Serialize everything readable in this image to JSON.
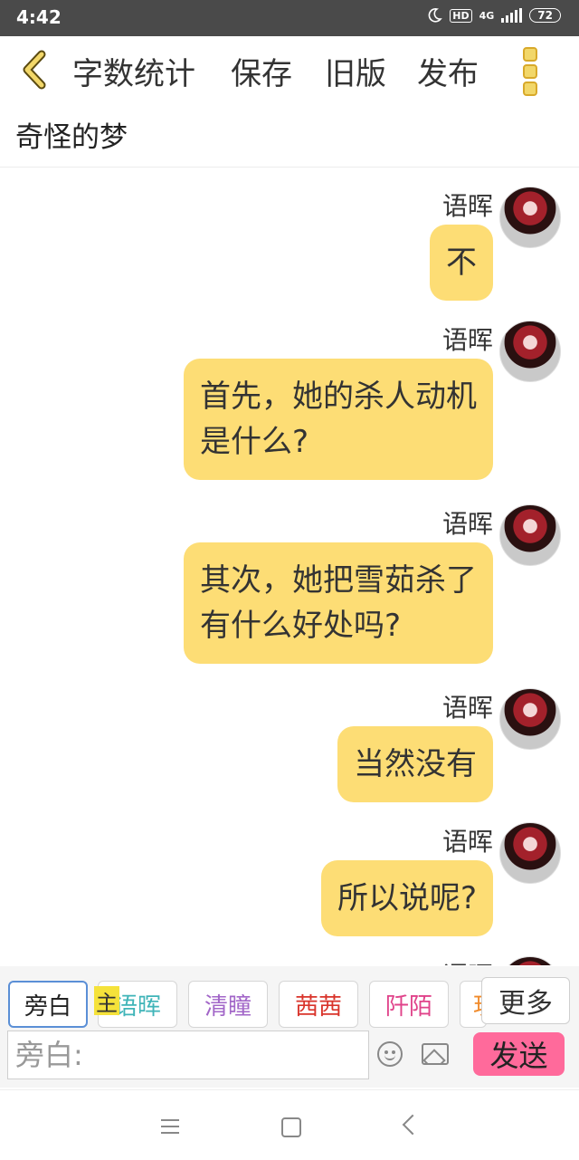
{
  "status_bar": {
    "time": "4:42",
    "hd": "HD",
    "network": "4G",
    "battery": "72"
  },
  "toolbar": {
    "word_count": "字数统计",
    "save": "保存",
    "old_version": "旧版",
    "publish": "发布"
  },
  "document": {
    "title": "奇怪的梦"
  },
  "messages": [
    {
      "name": "语晖",
      "text": "不"
    },
    {
      "name": "语晖",
      "lines": [
        "首先，她的杀人动机",
        "是什么?"
      ]
    },
    {
      "name": "语晖",
      "lines": [
        "其次，她把雪茹杀了",
        "有什么好处吗?"
      ]
    },
    {
      "name": "语晖",
      "text": "当然没有"
    },
    {
      "name": "语晖",
      "text": "所以说呢?"
    },
    {
      "name": "语晖"
    }
  ],
  "roles": {
    "items": [
      {
        "label": "旁白",
        "color": "#333333"
      },
      {
        "label": "语晖",
        "color": "#3fb4b8"
      },
      {
        "label": "清瞳",
        "color": "#a266c8"
      },
      {
        "label": "茜茜",
        "color": "#d9342b"
      },
      {
        "label": "阡陌",
        "color": "#e0438a"
      },
      {
        "label": "玥",
        "color": "#f08a2a"
      }
    ],
    "host_badge": "主",
    "more": "更多"
  },
  "composer": {
    "placeholder": "旁白:",
    "send": "发送"
  },
  "colors": {
    "bubble": "#fddd75",
    "send_button": "#ff6a9b",
    "back_arrow": "#e8c83a"
  }
}
